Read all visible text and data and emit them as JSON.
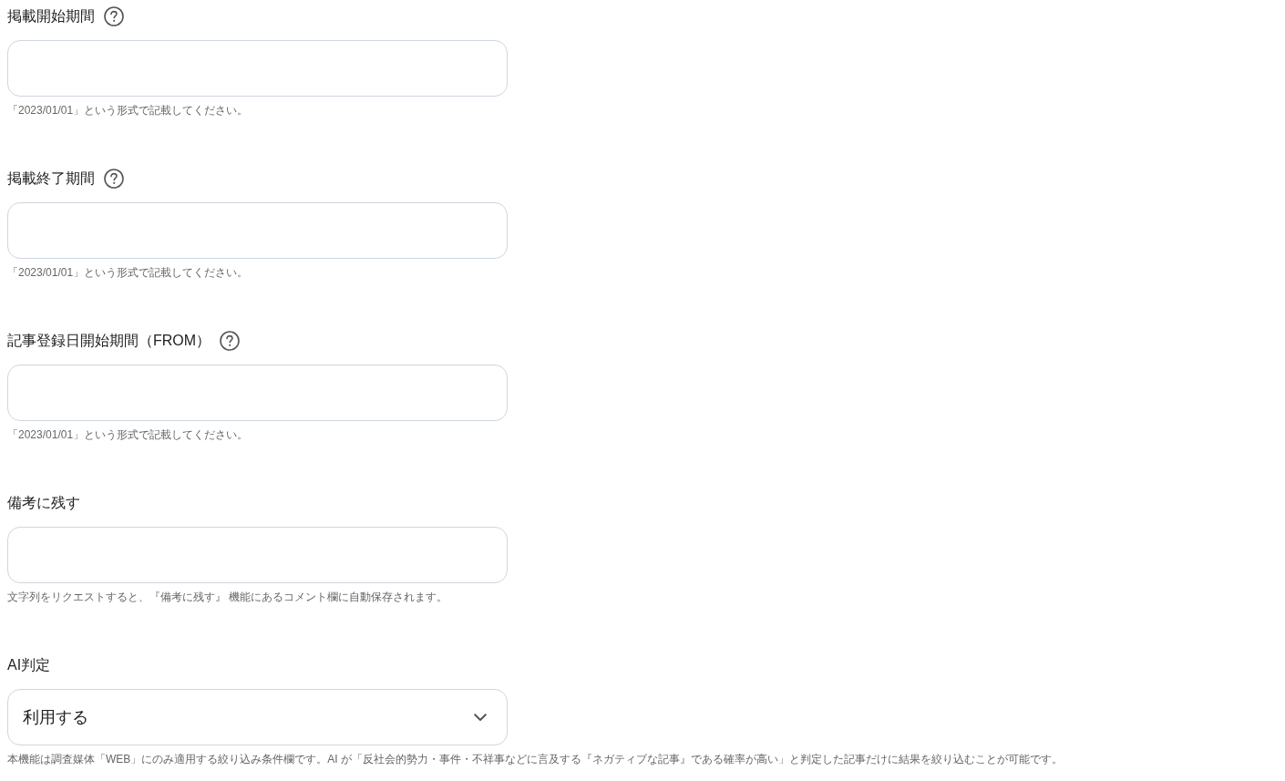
{
  "fields": [
    {
      "kind": "input",
      "label": "掲載開始期間",
      "help_icon": true,
      "note": "「2023/01/01」という形式で記載してください。"
    },
    {
      "kind": "input",
      "label": "掲載終了期間",
      "help_icon": true,
      "note": "「2023/01/01」という形式で記載してください。"
    },
    {
      "kind": "input",
      "label": "記事登録日開始期間（FROM）",
      "help_icon": true,
      "note": "「2023/01/01」という形式で記載してください。"
    },
    {
      "kind": "input",
      "label": "備考に残す",
      "help_icon": false,
      "note": "文字列をリクエストすると、『備考に残す』 機能にあるコメント欄に自動保存されます。"
    },
    {
      "kind": "select",
      "label": "AI判定",
      "help_icon": false,
      "value": "利用する",
      "note": "本機能は調査媒体「WEB」にのみ適用する絞り込み条件欄です。AI が「反社会的勢力・事件・不祥事などに言及する『ネガティブな記事』である確率が高い」と判定した記事だけに結果を絞り込むことが可能です。"
    }
  ]
}
